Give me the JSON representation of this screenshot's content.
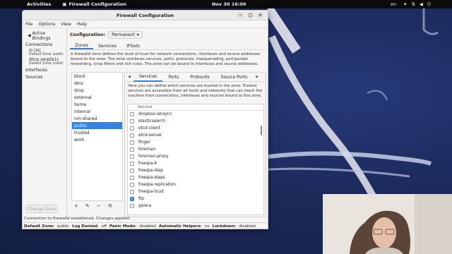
{
  "topbar": {
    "activities": "Activities",
    "app_name": "Firewall Configuration",
    "clock": "Nov 30  16:00",
    "lang": "en"
  },
  "window": {
    "title": "Firewall Configuration",
    "menu": [
      "File",
      "Options",
      "View",
      "Help"
    ]
  },
  "sidebar": {
    "bindings_label": "Active Bindings",
    "connections_label": "Connections",
    "connections": [
      {
        "name": "lo (lo)",
        "zone": "Default Zone: public"
      },
      {
        "name": "dhcp (enp0s1)",
        "zone": "Default Zone: public"
      }
    ],
    "interfaces_label": "Interfaces",
    "sources_label": "Sources",
    "change_zone_label": "Change Zone"
  },
  "main": {
    "config_label": "Configuration:",
    "config_value": "Permanent",
    "tabs": [
      "Zones",
      "Services",
      "IPSets"
    ],
    "zone_desc": "A firewalld zone defines the level of trust for network connections, interfaces and source addresses bound to the zone. The zone combines services, ports, protocols, masquerading, port/packet forwarding, icmp filters and rich rules. The zone can be bound to interfaces and source addresses.",
    "zones": [
      "block",
      "dmz",
      "drop",
      "external",
      "home",
      "internal",
      "nm-shared",
      "public",
      "trusted",
      "work"
    ],
    "selected_zone": "public",
    "zone_tools": [
      "+",
      "✎",
      "−",
      "⟲"
    ],
    "sub_tabs": [
      "Services",
      "Ports",
      "Protocols",
      "Source Ports"
    ],
    "svc_desc": "Here you can define which services are trusted in the zone. Trusted services are accessible from all hosts and networks that can reach the machine from connections, interfaces and sources bound to this zone.",
    "svc_header": "Service",
    "services": [
      {
        "name": "dropbox-lansync",
        "checked": false
      },
      {
        "name": "elasticsearch",
        "checked": false
      },
      {
        "name": "etcd-client",
        "checked": false
      },
      {
        "name": "etcd-server",
        "checked": false
      },
      {
        "name": "finger",
        "checked": false
      },
      {
        "name": "foreman",
        "checked": false
      },
      {
        "name": "foreman-proxy",
        "checked": false
      },
      {
        "name": "freeipa-4",
        "checked": false
      },
      {
        "name": "freeipa-ldap",
        "checked": false
      },
      {
        "name": "freeipa-ldaps",
        "checked": false
      },
      {
        "name": "freeipa-replication",
        "checked": false
      },
      {
        "name": "freeipa-trust",
        "checked": false
      },
      {
        "name": "ftp",
        "checked": true
      },
      {
        "name": "galera",
        "checked": false
      }
    ]
  },
  "status": {
    "message": "Connection to firewalld established. Changes applied.",
    "default_zone_label": "Default Zone:",
    "default_zone": "public",
    "log_denied_label": "Log Denied:",
    "log_denied": "off",
    "panic_label": "Panic Mode:",
    "panic": "disabled",
    "helpers_label": "Automatic Helpers:",
    "helpers": "no",
    "lockdown_label": "Lockdown:",
    "lockdown": "disabled"
  },
  "colors": {
    "accent": "#3584e4",
    "wallpaper": "#1b2a55"
  }
}
